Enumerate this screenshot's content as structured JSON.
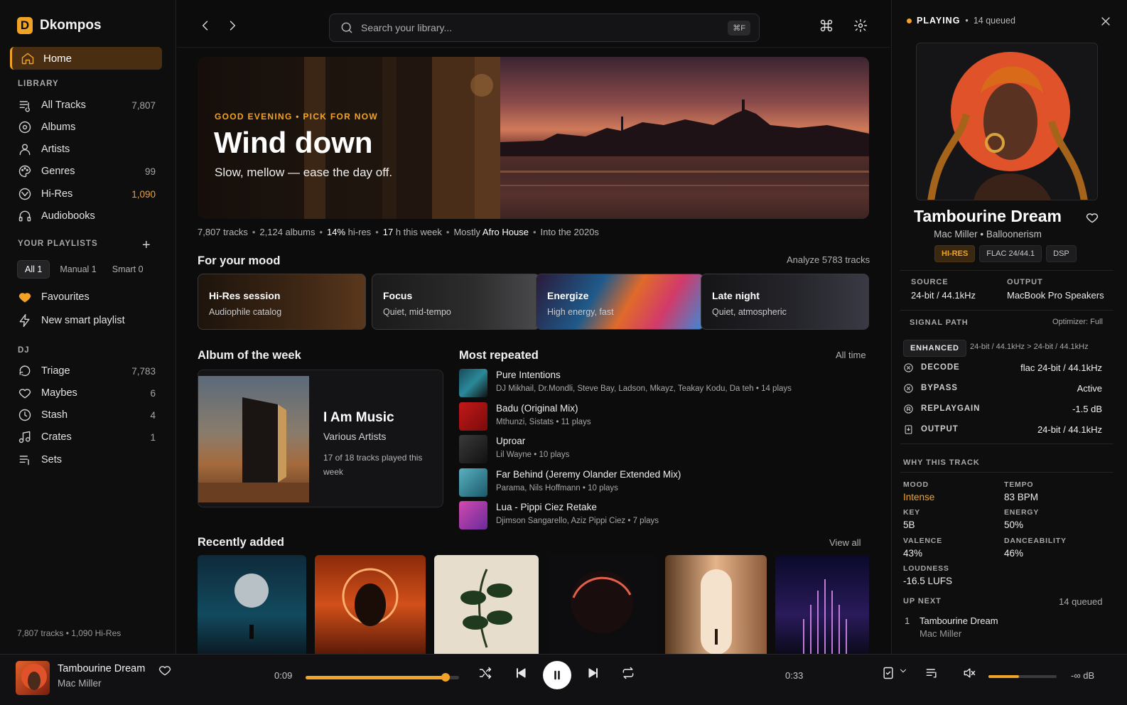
{
  "app": {
    "name": "Dkompos",
    "logo_letter": "D",
    "accent": "#f1a326"
  },
  "sidebar": {
    "home_label": "Home",
    "library_title": "LIBRARY",
    "library": [
      {
        "label": "All Tracks",
        "count": "7,807",
        "icon": "list-music-icon"
      },
      {
        "label": "Albums",
        "count": "",
        "icon": "album-icon"
      },
      {
        "label": "Artists",
        "count": "",
        "icon": "person-icon"
      },
      {
        "label": "Genres",
        "count": "99",
        "icon": "palette-icon"
      },
      {
        "label": "Hi-Res",
        "count": "1,090",
        "icon": "hi-res-icon"
      },
      {
        "label": "Audiobooks",
        "count": "",
        "icon": "headphones-icon"
      }
    ],
    "playlists_title": "YOUR PLAYLISTS",
    "filters": {
      "all": "All 1",
      "manual": "Manual 1",
      "smart": "Smart 0"
    },
    "favourites": "Favourites",
    "new_smart": "New smart playlist",
    "dj_title": "DJ",
    "dj": [
      {
        "label": "Triage",
        "count": "7,783"
      },
      {
        "label": "Maybes",
        "count": "6"
      },
      {
        "label": "Stash",
        "count": "4"
      },
      {
        "label": "Crates",
        "count": "1"
      },
      {
        "label": "Sets",
        "count": ""
      }
    ],
    "footer": "7,807 tracks • 1,090 Hi-Res"
  },
  "topbar": {
    "search_placeholder": "Search your library...",
    "shortcut": "⌘F"
  },
  "hero": {
    "eyebrow": "GOOD EVENING • PICK FOR NOW",
    "title": "Wind down",
    "subtitle": "Slow, mellow — ease the day off."
  },
  "stats": {
    "tracks": "7,807 tracks",
    "albums": "2,124 albums",
    "hires_pct": "14%",
    "hires_label": "hi-res",
    "hours": "17",
    "hours_label": "h this week",
    "mostly_label": "Mostly",
    "mostly_genre": "Afro House",
    "era": "Into the 2020s"
  },
  "mood": {
    "title": "For your mood",
    "action": "Analyze 5783 tracks",
    "cards": [
      {
        "title": "Hi-Res session",
        "sub": "Audiophile catalog"
      },
      {
        "title": "Focus",
        "sub": "Quiet, mid-tempo"
      },
      {
        "title": "Energize",
        "sub": "High energy, fast"
      },
      {
        "title": "Late night",
        "sub": "Quiet, atmospheric"
      }
    ]
  },
  "album_week": {
    "heading": "Album of the week",
    "title": "I Am Music",
    "artist": "Various Artists",
    "note": "17 of 18 tracks played this week"
  },
  "most_repeated": {
    "heading": "Most repeated",
    "filter": "All time",
    "tracks": [
      {
        "title": "Pure Intentions",
        "artists": "DJ Mikhail, Dr.Mondli, Steve Bay, Ladson, Mkayz, Teakay Kodu, Da teh",
        "plays": "14 plays"
      },
      {
        "title": "Badu (Original Mix)",
        "artists": "Mthunzi, Sistats",
        "plays": "11 plays"
      },
      {
        "title": "Uproar",
        "artists": "Lil Wayne",
        "plays": "10 plays"
      },
      {
        "title": "Far Behind (Jeremy Olander Extended Mix)",
        "artists": "Parama, Nils Hoffmann",
        "plays": "10 plays"
      },
      {
        "title": "Lua - Pippi Ciez Retake",
        "artists": "Djimson Sangarello, Aziz Pippi Ciez",
        "plays": "7 plays"
      }
    ]
  },
  "recent": {
    "heading": "Recently added",
    "action": "View all"
  },
  "now_playing": {
    "status": "PLAYING",
    "queued": "14 queued",
    "title": "Tambourine Dream",
    "artist": "Mac Miller",
    "album": "Balloonerism",
    "badges": [
      "HI-RES",
      "FLAC 24/44.1",
      "DSP"
    ],
    "source_label": "SOURCE",
    "source": "24-bit / 44.1kHz",
    "output_label": "OUTPUT",
    "output": "MacBook Pro Speakers",
    "signal_label": "SIGNAL PATH",
    "optimizer": "Optimizer: Full",
    "enhanced": "ENHANCED",
    "enhanced_path": "24-bit / 44.1kHz > 24-bit / 44.1kHz",
    "signal": [
      {
        "name": "DECODE",
        "value": "flac 24-bit / 44.1kHz"
      },
      {
        "name": "BYPASS",
        "value": "Active"
      },
      {
        "name": "REPLAYGAIN",
        "value": "-1.5 dB"
      },
      {
        "name": "OUTPUT",
        "value": "24-bit / 44.1kHz"
      }
    ],
    "why_label": "WHY THIS TRACK",
    "why": {
      "mood_l": "MOOD",
      "mood": "Intense",
      "tempo_l": "TEMPO",
      "tempo": "83 BPM",
      "key_l": "KEY",
      "key": "5B",
      "energy_l": "ENERGY",
      "energy": "50%",
      "valence_l": "VALENCE",
      "valence": "43%",
      "dance_l": "DANCEABILITY",
      "dance": "46%",
      "loud_l": "LOUDNESS",
      "loud": "-16.5 LUFS"
    },
    "up_next_label": "UP NEXT",
    "up_next_count": "14 queued",
    "up_next": [
      {
        "n": "1",
        "title": "Tambourine Dream",
        "artist": "Mac Miller"
      }
    ]
  },
  "player": {
    "title": "Tambourine Dream",
    "artist": "Mac Miller",
    "elapsed": "0:09",
    "remaining": "0:33",
    "progress": 0.91,
    "volume": 0.45,
    "volume_db": "-∞ dB"
  }
}
